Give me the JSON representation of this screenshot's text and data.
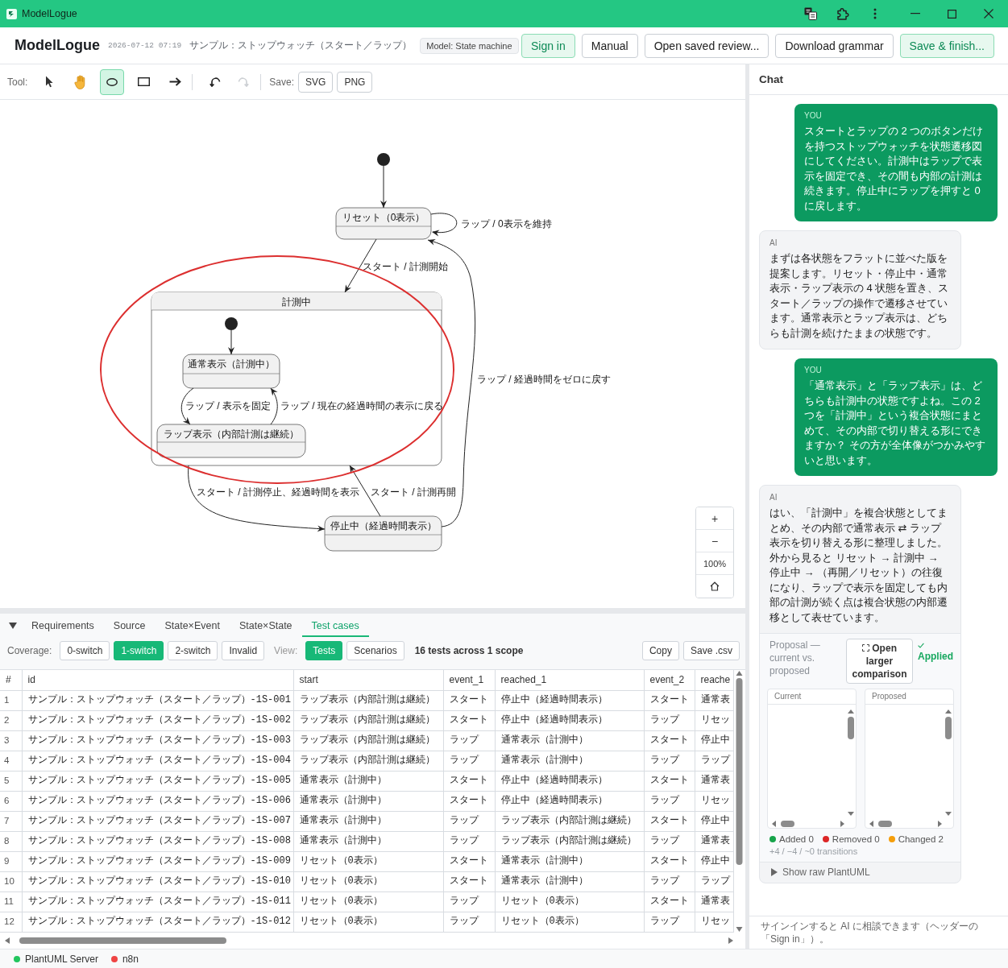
{
  "window": {
    "title": "ModelLogue"
  },
  "header": {
    "app_name": "ModelLogue",
    "timestamp": "2026-07-12 07:19",
    "document_title": "サンプル：ストップウォッチ（スタート／ラップ）",
    "model_badge": "Model: State machine",
    "buttons": [
      {
        "label": "Sign in",
        "kind": "accent"
      },
      {
        "label": "Manual",
        "kind": "plain"
      },
      {
        "label": "Open saved review...",
        "kind": "plain"
      },
      {
        "label": "Download grammar",
        "kind": "plain"
      },
      {
        "label": "Save & finish...",
        "kind": "accent"
      }
    ]
  },
  "toolbar": {
    "tool_label": "Tool:",
    "tools": [
      {
        "kind": "pointer",
        "selected": false
      },
      {
        "kind": "hand",
        "selected": false
      },
      {
        "kind": "ellipse",
        "selected": true
      },
      {
        "kind": "rectangle",
        "selected": false
      },
      {
        "kind": "arrow",
        "selected": false
      }
    ],
    "history": [
      {
        "kind": "undo",
        "disabled": false
      },
      {
        "kind": "redo",
        "disabled": true
      }
    ],
    "save_label": "Save:",
    "save_buttons": [
      "SVG",
      "PNG"
    ]
  },
  "diagram": {
    "states": [
      {
        "kind": "simple",
        "name": "リセット（0表示）"
      },
      {
        "kind": "composite",
        "name": "計測中"
      },
      {
        "kind": "simple",
        "name": "通常表示（計測中）"
      },
      {
        "kind": "simple",
        "name": "ラップ表示（内部計測は継続）"
      },
      {
        "kind": "simple",
        "name": "停止中（経過時間表示）"
      }
    ],
    "transitions": [
      "ラップ / 0表示を維持",
      "スタート / 計測開始",
      "ラップ / 経過時間をゼロに戻す",
      "ラップ / 表示を固定",
      "ラップ / 現在の経過時間の表示に戻る",
      "スタート / 計測停止、経過時間を表示",
      "スタート / 計測再開"
    ],
    "zoom_controls": {
      "zoom_in": "+",
      "zoom_out": "−",
      "zoom_percent": "100%"
    }
  },
  "bottom_panel": {
    "tabs": [
      {
        "label": "Requirements",
        "selected": false
      },
      {
        "label": "Source",
        "selected": false
      },
      {
        "label": "State×Event",
        "selected": false
      },
      {
        "label": "State×State",
        "selected": false
      },
      {
        "label": "Test cases",
        "selected": true
      }
    ],
    "coverage_label": "Coverage:",
    "coverage": [
      {
        "label": "0-switch",
        "selected": false
      },
      {
        "label": "1-switch",
        "selected": true
      },
      {
        "label": "2-switch",
        "selected": false
      },
      {
        "label": "Invalid",
        "selected": false
      }
    ],
    "view_label": "View:",
    "views": [
      {
        "label": "Tests",
        "selected": true
      },
      {
        "label": "Scenarios",
        "selected": false
      }
    ],
    "summary": "16 tests across 1 scope",
    "actions": [
      "Copy",
      "Save .csv"
    ]
  },
  "table": {
    "columns": [
      "#",
      "id",
      "start",
      "event_1",
      "reached_1",
      "event_2",
      "reache"
    ],
    "rows": [
      [
        "1",
        "サンプル：ストップウォッチ（スタート／ラップ）-1S-001",
        "ラップ表示（内部計測は継続）",
        "スタート",
        "停止中（経過時間表示）",
        "スタート",
        "通常表"
      ],
      [
        "2",
        "サンプル：ストップウォッチ（スタート／ラップ）-1S-002",
        "ラップ表示（内部計測は継続）",
        "スタート",
        "停止中（経過時間表示）",
        "ラップ",
        "リセッ"
      ],
      [
        "3",
        "サンプル：ストップウォッチ（スタート／ラップ）-1S-003",
        "ラップ表示（内部計測は継続）",
        "ラップ",
        "通常表示（計測中）",
        "スタート",
        "停止中"
      ],
      [
        "4",
        "サンプル：ストップウォッチ（スタート／ラップ）-1S-004",
        "ラップ表示（内部計測は継続）",
        "ラップ",
        "通常表示（計測中）",
        "ラップ",
        "ラップ"
      ],
      [
        "5",
        "サンプル：ストップウォッチ（スタート／ラップ）-1S-005",
        "通常表示（計測中）",
        "スタート",
        "停止中（経過時間表示）",
        "スタート",
        "通常表"
      ],
      [
        "6",
        "サンプル：ストップウォッチ（スタート／ラップ）-1S-006",
        "通常表示（計測中）",
        "スタート",
        "停止中（経過時間表示）",
        "ラップ",
        "リセッ"
      ],
      [
        "7",
        "サンプル：ストップウォッチ（スタート／ラップ）-1S-007",
        "通常表示（計測中）",
        "ラップ",
        "ラップ表示（内部計測は継続）",
        "スタート",
        "停止中"
      ],
      [
        "8",
        "サンプル：ストップウォッチ（スタート／ラップ）-1S-008",
        "通常表示（計測中）",
        "ラップ",
        "ラップ表示（内部計測は継続）",
        "ラップ",
        "通常表"
      ],
      [
        "9",
        "サンプル：ストップウォッチ（スタート／ラップ）-1S-009",
        "リセット（0表示）",
        "スタート",
        "通常表示（計測中）",
        "スタート",
        "停止中"
      ],
      [
        "10",
        "サンプル：ストップウォッチ（スタート／ラップ）-1S-010",
        "リセット（0表示）",
        "スタート",
        "通常表示（計測中）",
        "ラップ",
        "ラップ"
      ],
      [
        "11",
        "サンプル：ストップウォッチ（スタート／ラップ）-1S-011",
        "リセット（0表示）",
        "ラップ",
        "リセット（0表示）",
        "スタート",
        "通常表"
      ],
      [
        "12",
        "サンプル：ストップウォッチ（スタート／ラップ）-1S-012",
        "リセット（0表示）",
        "ラップ",
        "リセット（0表示）",
        "ラップ",
        "リセッ"
      ]
    ]
  },
  "status_bar": [
    {
      "label": "PlantUML Server",
      "color": "#22c55e"
    },
    {
      "label": "n8n",
      "color": "#ef4444"
    }
  ],
  "chat": {
    "title": "Chat",
    "messages": [
      {
        "kind": "user",
        "sender": "YOU",
        "text": "スタートとラップの 2 つのボタンだけを持つストップウォッチを状態遷移図にしてください。計測中はラップで表示を固定でき、その間も内部の計測は続きます。停止中にラップを押すと 0 に戻します。"
      },
      {
        "kind": "ai",
        "sender": "AI",
        "text": "まずは各状態をフラットに並べた版を提案します。リセット・停止中・通常表示・ラップ表示の 4 状態を置き、スタート／ラップの操作で遷移させています。通常表示とラップ表示は、どちらも計測を続けたままの状態です。"
      },
      {
        "kind": "user",
        "sender": "YOU",
        "text": "「通常表示」と「ラップ表示」は、どちらも計測中の状態ですよね。この 2 つを「計測中」という複合状態にまとめて、その内部で切り替える形にできますか？ その方が全体像がつかみやすいと思います。"
      },
      {
        "kind": "ai",
        "sender": "AI",
        "text": "はい、「計測中」を複合状態としてまとめ、その内部で通常表示 ⇄ ラップ表示を切り替える形に整理しました。外から見ると リセット → 計測中 → 停止中 → （再開／リセット）の往復になり、ラップで表示を固定しても内部の計測が続く点は複合状態の内部遷移として表せています。",
        "proposal": {
          "caption": "Proposal — current vs. proposed",
          "open_button": "Open larger comparison",
          "status": "Applied",
          "panels": [
            "Current",
            "Proposed"
          ],
          "legend": [
            {
              "label": "Added 0",
              "color": "#16a34a"
            },
            {
              "label": "Removed 0",
              "color": "#dc2626"
            },
            {
              "label": "Changed 2",
              "color": "#f59e0b"
            }
          ],
          "transitions_summary": "+4 / −4 / ~0 transitions",
          "raw_toggle": "Show raw PlantUML"
        }
      }
    ],
    "footer": "サインインすると AI に相談できます（ヘッダーの「Sign in」）。"
  }
}
